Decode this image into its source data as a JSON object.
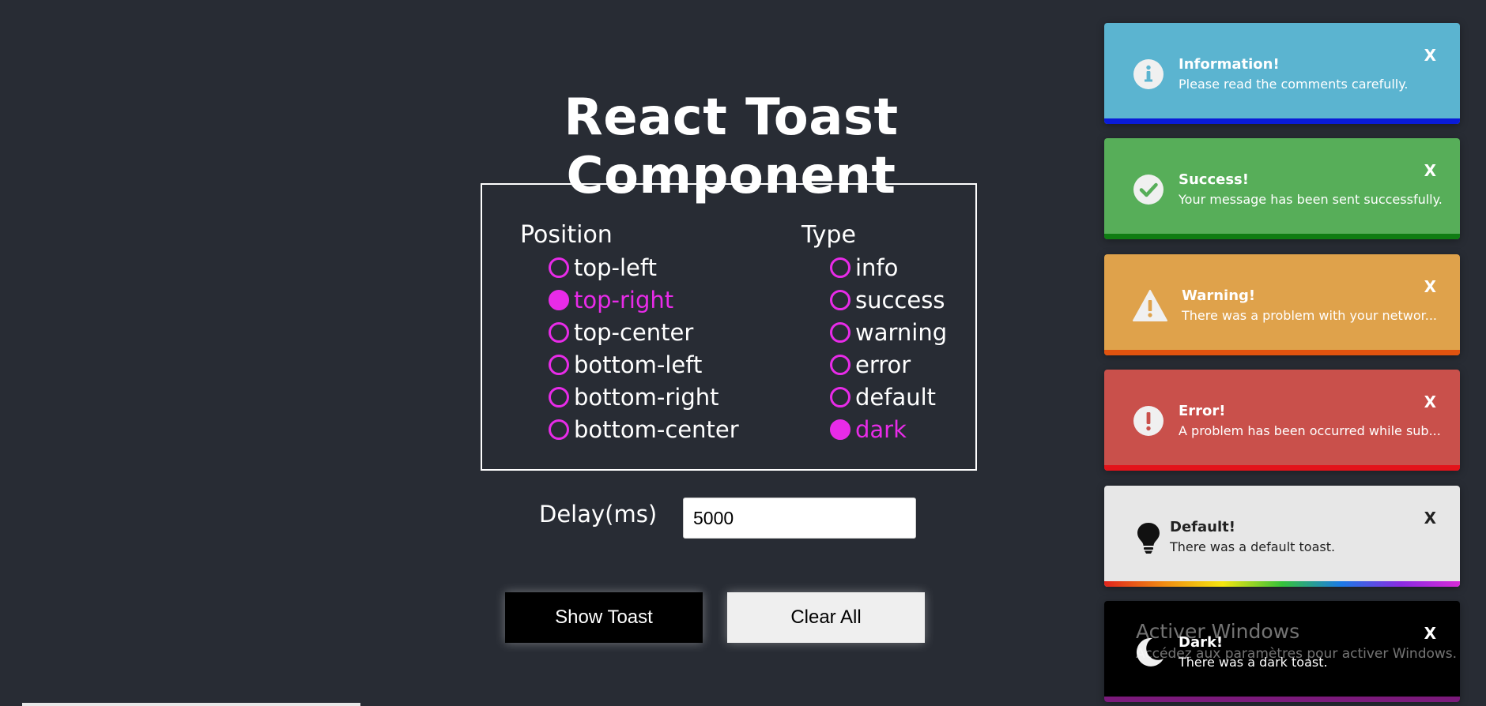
{
  "title": "React Toast Component",
  "position": {
    "label": "Position",
    "options": [
      "top-left",
      "top-right",
      "top-center",
      "bottom-left",
      "bottom-right",
      "bottom-center"
    ],
    "selected": "top-right"
  },
  "type": {
    "label": "Type",
    "options": [
      "info",
      "success",
      "warning",
      "error",
      "default",
      "dark"
    ],
    "selected": "dark"
  },
  "delay": {
    "label": "Delay(ms)",
    "value": "5000"
  },
  "buttons": {
    "show": "Show Toast",
    "clear": "Clear All"
  },
  "colors": {
    "accent": "#e82be8",
    "background": "#282c34"
  },
  "toasts": [
    {
      "type": "info",
      "title": "Information!",
      "message": "Please read the comments carefully.",
      "icon": "info-icon",
      "close": "X",
      "color": "#5bb4d0"
    },
    {
      "type": "success",
      "title": "Success!",
      "message": "Your message has been sent successfully.",
      "icon": "check-circle-icon",
      "close": "X",
      "color": "#57ae59"
    },
    {
      "type": "warning",
      "title": "Warning!",
      "message": "There was a problem with your networ...",
      "icon": "warning-triangle-icon",
      "close": "X",
      "color": "#dfa24b"
    },
    {
      "type": "error",
      "title": "Error!",
      "message": "A problem has been occurred while sub...",
      "icon": "exclamation-circle-icon",
      "close": "X",
      "color": "#c9504b"
    },
    {
      "type": "default",
      "title": "Default!",
      "message": "There was a default toast.",
      "icon": "lightbulb-icon",
      "close": "X",
      "color": "#e7e7e7"
    },
    {
      "type": "dark",
      "title": "Dark!",
      "message": "There was a dark toast.",
      "icon": "moon-icon",
      "close": "X",
      "color": "#000000"
    }
  ],
  "watermark": {
    "title": "Activer Windows",
    "subtitle": "Accédez aux paramètres pour activer Windows."
  }
}
